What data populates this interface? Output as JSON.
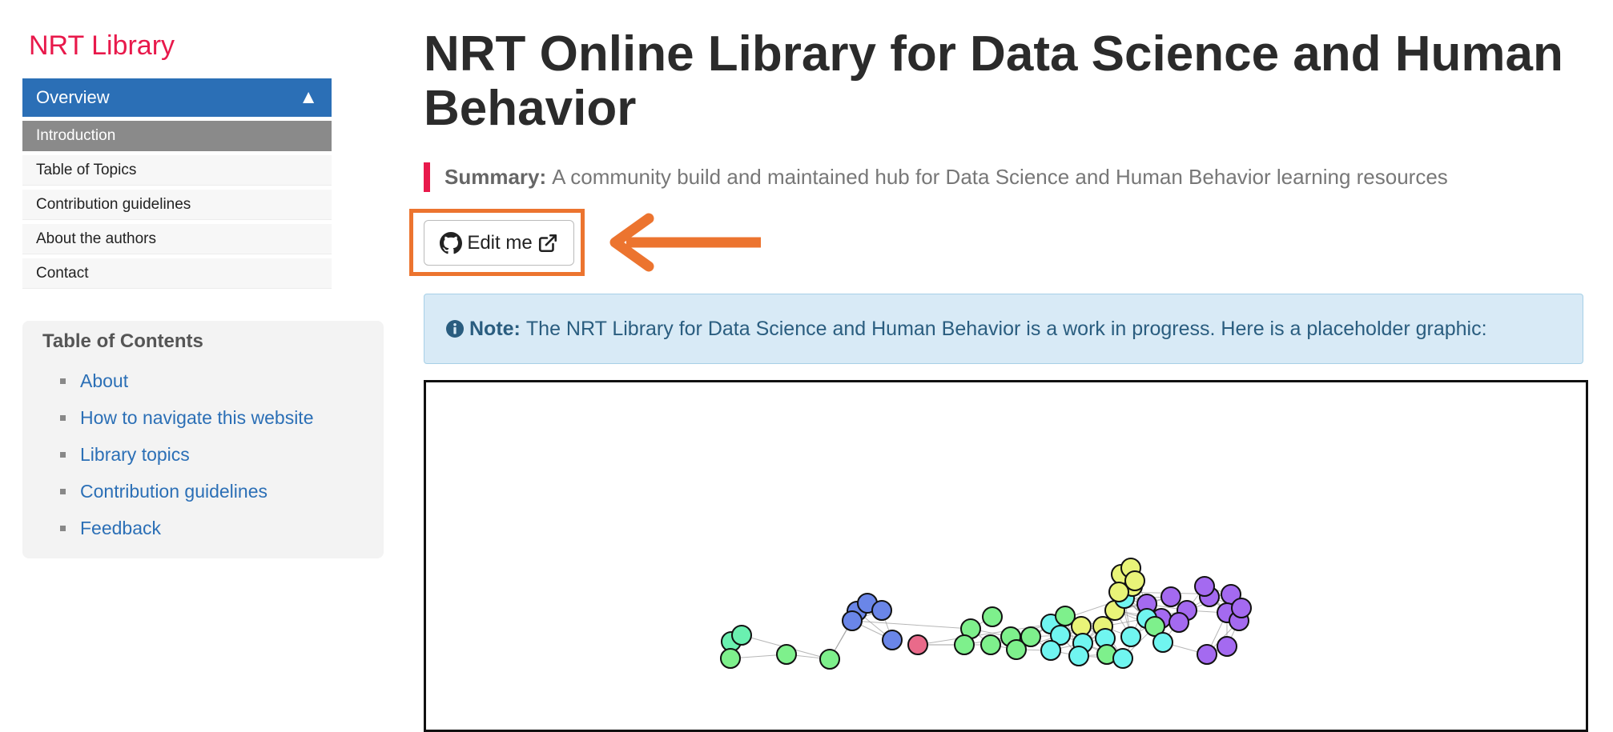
{
  "sidebar": {
    "brand": "NRT Library",
    "nav": {
      "section_label": "Overview",
      "toggle_glyph": "▲",
      "items": [
        {
          "label": "Introduction",
          "active": true
        },
        {
          "label": "Table of Topics",
          "active": false
        },
        {
          "label": "Contribution guidelines",
          "active": false
        },
        {
          "label": "About the authors",
          "active": false
        },
        {
          "label": "Contact",
          "active": false
        }
      ]
    },
    "toc": {
      "title": "Table of Contents",
      "items": [
        {
          "label": "About"
        },
        {
          "label": "How to navigate this website"
        },
        {
          "label": "Library topics"
        },
        {
          "label": "Contribution guidelines"
        },
        {
          "label": "Feedback"
        }
      ]
    }
  },
  "main": {
    "title": "NRT Online Library for Data Science and Human Behavior",
    "summary_label": "Summary:",
    "summary_text": "A community build and maintained hub for Data Science and Human Behavior learning resources",
    "edit_button_label": "Edit me",
    "note_label": "Note:",
    "note_text": "The NRT Library for Data Science and Human Behavior is a work in progress. Here is a placeholder graphic:",
    "graph_node_colors": [
      "#6a86e8",
      "#e96a8a",
      "#7ef08c",
      "#70f5f0",
      "#e9f478",
      "#a46af0",
      "#6af0b0"
    ]
  },
  "colors": {
    "brand": "#e8194b",
    "nav_active_bg": "#2b6fb6",
    "link": "#2b6fb6",
    "annotation": "#ec742f"
  },
  "icons": [
    "github-icon",
    "external-link-icon",
    "info-circle-icon",
    "arrow-left-icon",
    "triangle-up-icon"
  ]
}
